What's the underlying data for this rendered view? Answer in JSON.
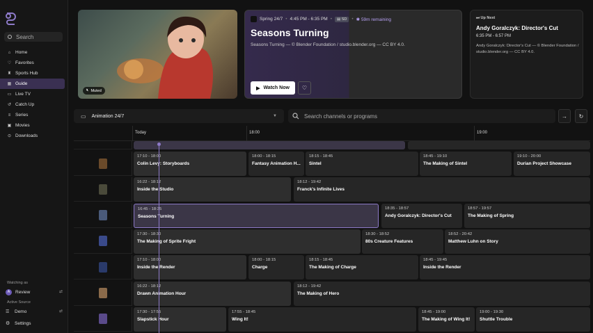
{
  "sidebar": {
    "search_placeholder": "Search",
    "items": [
      {
        "label": "Home",
        "icon": "home-icon",
        "glyph": "⌂"
      },
      {
        "label": "Favorites",
        "icon": "heart-icon",
        "glyph": "♡"
      },
      {
        "label": "Sports Hub",
        "icon": "trophy-icon",
        "glyph": "♜"
      },
      {
        "label": "Guide",
        "icon": "grid-icon",
        "glyph": "▦",
        "active": true
      },
      {
        "label": "Live TV",
        "icon": "tv-icon",
        "glyph": "▭"
      },
      {
        "label": "Catch Up",
        "icon": "history-icon",
        "glyph": "↺"
      },
      {
        "label": "Series",
        "icon": "layers-icon",
        "glyph": "≡"
      },
      {
        "label": "Movies",
        "icon": "film-icon",
        "glyph": "▣"
      },
      {
        "label": "Downloads",
        "icon": "download-icon",
        "glyph": "⊙"
      }
    ],
    "watching_as_label": "Watching as",
    "profile_initial": "A",
    "profile_name": "Review",
    "active_source_label": "Active Source",
    "source_name": "Demo",
    "settings_label": "Settings"
  },
  "hero": {
    "muted_label": "Muted",
    "channel": "Spring 24/7",
    "time": "4:45 PM - 6:35 PM",
    "quality": "SD",
    "remaining": "59m remaining",
    "title": "Seasons Turning",
    "subtitle": "Seasons Turning — © Blender Foundation / studio.blender.org — CC BY 4.0.",
    "watch_label": "Watch Now"
  },
  "up_next": {
    "label": "Up Next",
    "title": "Andy Goralczyk: Director's Cut",
    "time": "6:35 PM - 6:57 PM",
    "description": "Andy Goralczyk: Director's Cut — © Blender Foundation / studio.blender.org — CC BY 4.0."
  },
  "filter": {
    "category": "Animation 24/7",
    "search_placeholder": "Search channels or programs"
  },
  "guide": {
    "time_labels": [
      "Today",
      "18:00",
      "19:00"
    ],
    "rows": [
      {
        "thumb": "#6a4a2a",
        "programs": [
          {
            "time": "17:10 - 18:00",
            "title": "Colin Levy: Storyboards"
          },
          {
            "time": "18:00 - 18:15",
            "title": "Fantasy Animation H..."
          },
          {
            "time": "18:15 - 18:45",
            "title": "Sintel"
          },
          {
            "time": "18:45 - 19:10",
            "title": "The Making of Sintel"
          },
          {
            "time": "19:10 - 20:00",
            "title": "Durian Project Showcase"
          }
        ]
      },
      {
        "thumb": "#4a4a3a",
        "programs": [
          {
            "time": "16:22 - 18:12",
            "title": "Inside the Studio"
          },
          {
            "time": "18:12 - 19:42",
            "title": "Franck's Infinite Lives"
          }
        ]
      },
      {
        "thumb": "#4a5a7a",
        "programs": [
          {
            "time": "16:45 - 18:35",
            "title": "Seasons Turning"
          },
          {
            "time": "18:35 - 18:57",
            "title": "Andy Goralczyk: Director's Cut"
          },
          {
            "time": "18:57 - 19:57",
            "title": "The Making of Spring"
          }
        ]
      },
      {
        "thumb": "#3a4a8a",
        "programs": [
          {
            "time": "17:30 - 18:30",
            "title": "The Making of Sprite Fright"
          },
          {
            "time": "18:30 - 18:52",
            "title": "80s Creature Features"
          },
          {
            "time": "18:52 - 20:42",
            "title": "Matthew Luhn on Story"
          }
        ]
      },
      {
        "thumb": "#2a3a6a",
        "programs": [
          {
            "time": "17:10 - 18:00",
            "title": "Inside the Render"
          },
          {
            "time": "18:00 - 18:15",
            "title": "Charge"
          },
          {
            "time": "18:15 - 18:45",
            "title": "The Making of Charge"
          },
          {
            "time": "18:45 - 19:45",
            "title": "Inside the Render"
          }
        ]
      },
      {
        "thumb": "#8a6a4a",
        "programs": [
          {
            "time": "16:22 - 18:12",
            "title": "Drawn Animation Hour"
          },
          {
            "time": "18:12 - 19:42",
            "title": "The Making of Hero"
          }
        ]
      },
      {
        "thumb": "#5a4a8a",
        "programs": [
          {
            "time": "17:30 - 17:55",
            "title": "Slapstick Hour"
          },
          {
            "time": "17:55 - 18:45",
            "title": "Wing It!"
          },
          {
            "time": "18:45 - 19:00",
            "title": "The Making of Wing It!"
          },
          {
            "time": "19:00 - 19:30",
            "title": "Shuttle Trouble"
          }
        ]
      }
    ]
  }
}
